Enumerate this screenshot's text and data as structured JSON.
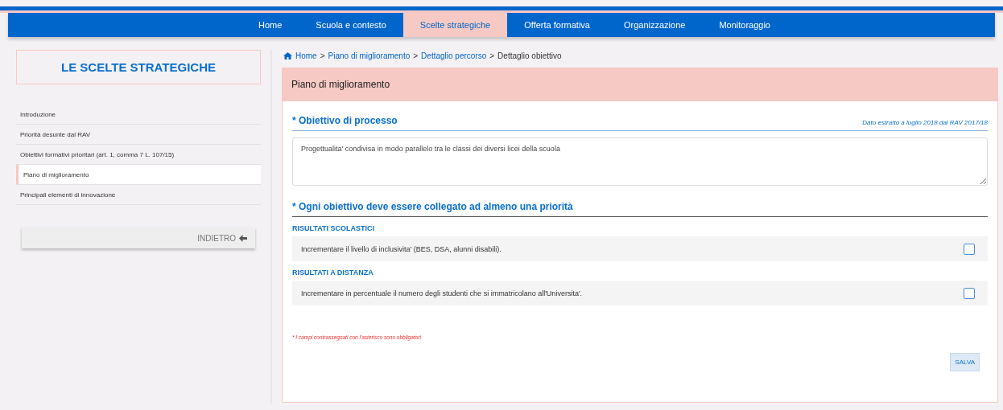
{
  "nav": {
    "items": [
      {
        "label": "Home",
        "selected": false
      },
      {
        "label": "Scuola e contesto",
        "selected": false
      },
      {
        "label": "Scelte strategiche",
        "selected": true
      },
      {
        "label": "Offerta formativa",
        "selected": false
      },
      {
        "label": "Organizzazione",
        "selected": false
      },
      {
        "label": "Monitoraggio",
        "selected": false
      }
    ]
  },
  "sidebar": {
    "title": "LE SCELTE STRATEGICHE",
    "items": [
      {
        "label": "Introduzione",
        "selected": false
      },
      {
        "label": "Priorità desunte dal RAV",
        "selected": false
      },
      {
        "label": "Obiettivi formativi prioritari (art. 1, comma 7 L. 107/15)",
        "selected": false
      },
      {
        "label": "Piano di miglioramento",
        "selected": true
      },
      {
        "label": "Principali elementi di innovazione",
        "selected": false
      }
    ],
    "back_button": "INDIETRO"
  },
  "breadcrumb": {
    "separator": ">",
    "items": [
      {
        "label": "Home",
        "kind": "link"
      },
      {
        "label": "Piano di miglioramento",
        "kind": "link"
      },
      {
        "label": "Dettaglio percorso",
        "kind": "link"
      },
      {
        "label": "Dettaglio obiettivo",
        "kind": "current"
      }
    ]
  },
  "panel": {
    "title": "Piano di miglioramento",
    "objective": {
      "heading": "* Obiettivo di processo",
      "note": "Dato estratto a luglio 2018 dal RAV 2017/18",
      "value": "Progettualita' condivisa in modo parallelo tra le classi dei diversi licei della scuola"
    },
    "priorities": {
      "heading": "* Ogni obiettivo deve essere collegato ad almeno una priorità",
      "groups": [
        {
          "title": "RISULTATI SCOLASTICI",
          "items": [
            {
              "label": "Incrementare il livello di inclusivita' (BES, DSA, alunni disabili).",
              "checked": false
            }
          ]
        },
        {
          "title": "RISULTATI A DISTANZA",
          "items": [
            {
              "label": "Incrementare in percentuale il numero degli studenti che si immatricolano all'Universita'.",
              "checked": false
            }
          ]
        }
      ]
    },
    "required_note": "* I campi contrassegnati con l'asterisco sono obbligatori",
    "save_button": "SALVA"
  }
}
